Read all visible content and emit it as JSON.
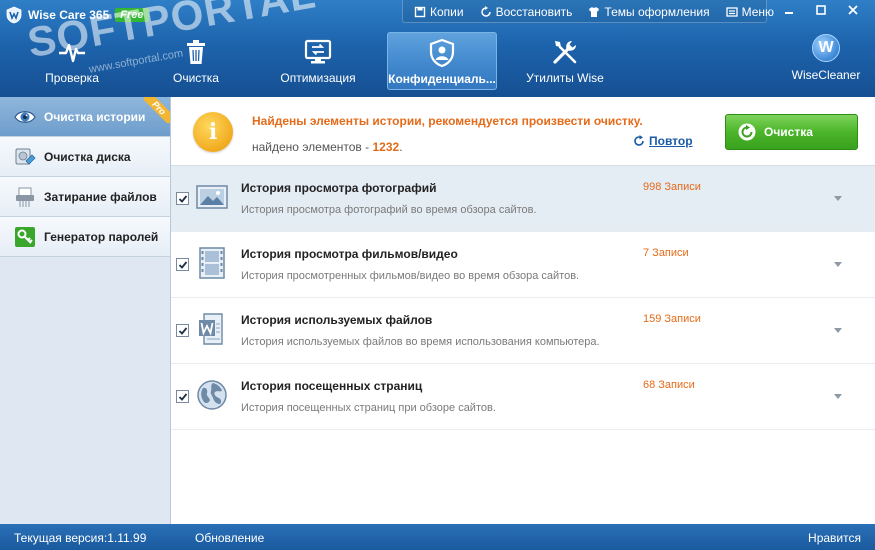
{
  "app": {
    "name": "Wise Care 365",
    "edition": "Free"
  },
  "watermark": {
    "text": "SOFTPORTAL",
    "url": "www.softportal.com"
  },
  "top_menu": {
    "backups": "Копии",
    "restore": "Восстановить",
    "themes": "Темы оформления",
    "menu": "Меню"
  },
  "nav": {
    "tabs": [
      {
        "label": "Проверка",
        "icon": "pulse-icon"
      },
      {
        "label": "Очистка",
        "icon": "trash-icon"
      },
      {
        "label": "Оптимизация",
        "icon": "monitor-icon"
      },
      {
        "label": "Конфиденциаль...",
        "icon": "shield-icon",
        "active": true
      },
      {
        "label": "Утилиты Wise",
        "icon": "tools-icon"
      }
    ],
    "brand": "WiseCleaner",
    "brand_letter": "W"
  },
  "sidebar": {
    "items": [
      {
        "label": "Очистка истории",
        "icon": "eye-icon",
        "active": true,
        "badge": "Pro"
      },
      {
        "label": "Очистка диска",
        "icon": "disk-eraser-icon"
      },
      {
        "label": "Затирание файлов",
        "icon": "shredder-icon"
      },
      {
        "label": "Генератор паролей",
        "icon": "key-icon"
      }
    ]
  },
  "notice": {
    "title": "Найдены элементы истории, рекомендуется произвести очистку.",
    "count_prefix": "найдено элементов - ",
    "count": "1232",
    "count_suffix": ".",
    "repeat_label": "Повтор",
    "clean_label": "Очистка"
  },
  "items": [
    {
      "title": "История просмотра фотографий",
      "desc": "История просмотра фотографий во время обзора сайтов.",
      "count": "998 Записи",
      "checked": true,
      "icon": "photo-icon"
    },
    {
      "title": "История просмотра фильмов/видео",
      "desc": "История просмотренных фильмов/видео во время обзора сайтов.",
      "count": "7 Записи",
      "checked": true,
      "icon": "film-icon"
    },
    {
      "title": "История используемых файлов",
      "desc": "История используемых файлов во время использования компьютера.",
      "count": "159 Записи",
      "checked": true,
      "icon": "word-document-icon"
    },
    {
      "title": "История посещенных страниц",
      "desc": "История посещенных страниц при обзоре сайтов.",
      "count": "68 Записи",
      "checked": true,
      "icon": "globe-icon"
    }
  ],
  "statusbar": {
    "version": "Текущая версия:1.11.99",
    "update": "Обновление",
    "like": "Нравится"
  },
  "colors": {
    "header": "#1d64ad",
    "accent_orange": "#e46b1a",
    "clean_green": "#4bb52a",
    "free_badge": "#35b534",
    "pro_badge": "#f3b632"
  }
}
